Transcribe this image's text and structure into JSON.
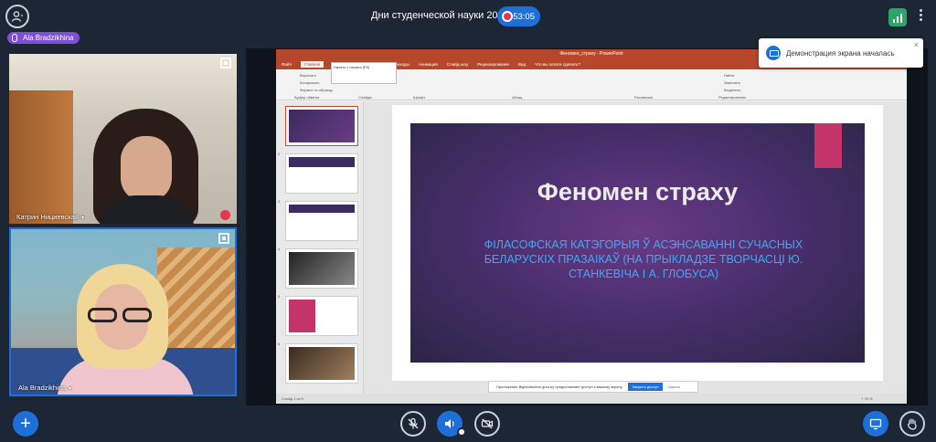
{
  "header": {
    "meeting_title": "Дни студенческой науки 2022",
    "timer": "53:05"
  },
  "speaker": {
    "name": "Ala Bradzikhina"
  },
  "participants": [
    {
      "name": "Катрин Нициевская"
    },
    {
      "name": "Ala Bradzikhina"
    }
  ],
  "toast": {
    "message": "Демонстрация экрана началась"
  },
  "powerpoint": {
    "window_title": "Феномен_страху - PowerPoint",
    "tabs": [
      "Файл",
      "Главная",
      "Вставка",
      "Конструктор",
      "Переходы",
      "Анимация",
      "Слайд-шоу",
      "Рецензирование",
      "Вид",
      "Что вы хотите сделать?"
    ],
    "tooltip": "Начать с начала (F5)",
    "ribbon_groups": [
      "Буфер обмена",
      "Слайды",
      "Шрифт",
      "Абзац",
      "Рисование",
      "Редактирование"
    ],
    "ribbon_items": [
      "Вырезать",
      "Копировать",
      "Формат по образцу",
      "Найти",
      "Заменить",
      "Выделить"
    ],
    "slide_title": "Феномен страху",
    "slide_subtitle": "ФІЛАСОФСКАЯ КАТЭГОРЫЯ Ў АСЭНСАВАННІ СУЧАСНЫХ БЕЛАРУСКІХ ПРАЗАІКАЎ (НА ПРЫКЛАДЗЕ ТВОРЧАСЦІ Ю. СТАНКЕВІЧА І А. ГЛОБУСА)",
    "thumbnail_numbers": [
      "1",
      "2",
      "3",
      "4",
      "5",
      "6"
    ],
    "status_left": "Слайд 1 из 9",
    "status_zoom": "+ 76 %",
    "notification": "Приложение Bigbluebutton.grsu.by предоставляет доступ к вашему экрану.",
    "notification_button": "Закрыть доступ",
    "notification_hide": "Скрыть"
  },
  "colors": {
    "accent": "#1f6fd9",
    "record": "#e2384f",
    "signal": "#2ea36a",
    "speaker_badge": "#7f4fd6",
    "ppt_red": "#b7472a"
  },
  "icons": {
    "user": "person-icon",
    "add": "plus-icon",
    "mic": "mic-muted-icon",
    "audio": "speaker-icon",
    "camera": "camera-off-icon",
    "screen_share": "screen-share-icon",
    "raise_hand": "hand-icon"
  }
}
